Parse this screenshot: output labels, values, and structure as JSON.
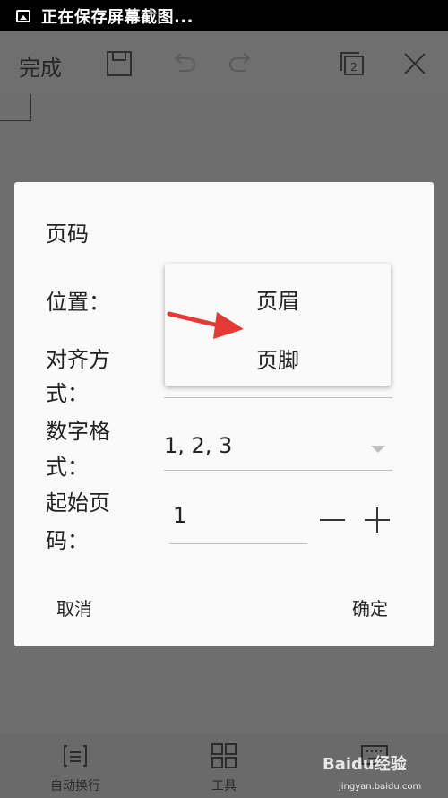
{
  "status_bar": {
    "text": "正在保存屏幕截图..."
  },
  "toolbar": {
    "done_label": "完成",
    "page_count_icon_text": "2"
  },
  "dialog": {
    "title": "页码",
    "position": {
      "label_line1": "位置："
    },
    "alignment": {
      "label_line1": "对齐方",
      "label_line2": "式："
    },
    "number_format": {
      "label_line1": "数字格",
      "label_line2": "式：",
      "value": "1, 2, 3"
    },
    "start_page": {
      "label_line1": "起始页",
      "label_line2": "码：",
      "value": "1"
    },
    "cancel_label": "取消",
    "confirm_label": "确定"
  },
  "dropdown": {
    "options": [
      "页眉",
      "页脚"
    ]
  },
  "bottom_bar": {
    "items": [
      {
        "label": "自动换行",
        "icon": "wrap-text-icon"
      },
      {
        "label": "工具",
        "icon": "grid-icon"
      },
      {
        "label": "",
        "icon": "keyboard-icon"
      }
    ]
  },
  "watermark": {
    "brand": "Baidu经验",
    "url": "jingyan.baidu.com"
  },
  "colors": {
    "accent": "#26a69a",
    "arrow": "#e53935",
    "overlay": "#6e6e6e"
  }
}
